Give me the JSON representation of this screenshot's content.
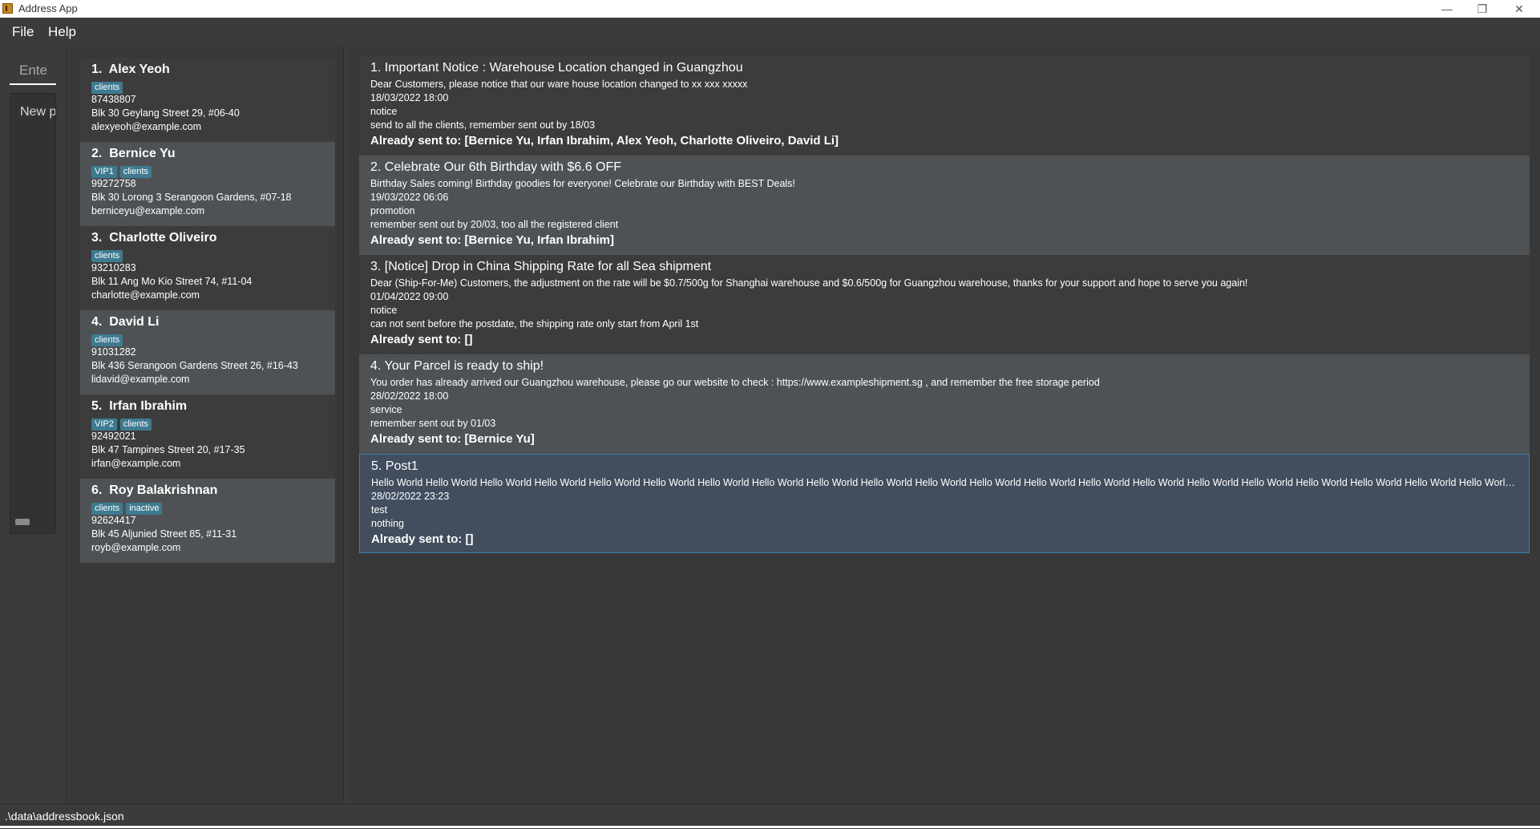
{
  "window": {
    "title": "Address App",
    "minimize": "—",
    "maximize": "❐",
    "close": "✕"
  },
  "menu": {
    "file": "File",
    "help": "Help"
  },
  "command_box": {
    "placeholder": "Ente"
  },
  "result_box": {
    "text": "New p"
  },
  "persons": [
    {
      "index": "1.",
      "name": "Alex Yeoh",
      "tags": [
        "clients"
      ],
      "phone": "87438807",
      "address": "Blk 30 Geylang Street 29, #06-40",
      "email": "alexyeoh@example.com"
    },
    {
      "index": "2.",
      "name": "Bernice Yu",
      "tags": [
        "VIP1",
        "clients"
      ],
      "phone": "99272758",
      "address": "Blk 30 Lorong 3 Serangoon Gardens, #07-18",
      "email": "berniceyu@example.com"
    },
    {
      "index": "3.",
      "name": "Charlotte Oliveiro",
      "tags": [
        "clients"
      ],
      "phone": "93210283",
      "address": "Blk 11 Ang Mo Kio Street 74, #11-04",
      "email": "charlotte@example.com"
    },
    {
      "index": "4.",
      "name": "David Li",
      "tags": [
        "clients"
      ],
      "phone": "91031282",
      "address": "Blk 436 Serangoon Gardens Street 26, #16-43",
      "email": "lidavid@example.com"
    },
    {
      "index": "5.",
      "name": "Irfan Ibrahim",
      "tags": [
        "VIP2",
        "clients"
      ],
      "phone": "92492021",
      "address": "Blk 47 Tampines Street 20, #17-35",
      "email": "irfan@example.com"
    },
    {
      "index": "6.",
      "name": "Roy Balakrishnan",
      "tags": [
        "clients",
        "inactive"
      ],
      "phone": "92624417",
      "address": "Blk 45 Aljunied Street 85, #11-31",
      "email": "royb@example.com"
    }
  ],
  "posts": [
    {
      "title": "1.  Important Notice :  Warehouse Location changed in Guangzhou",
      "content": "Dear Customers, please notice that our ware house location changed to xx xxx xxxxx",
      "datetime": "18/03/2022 18:00",
      "category": "notice",
      "note": "send to all the clients, remember sent out by 18/03",
      "sent": "Already sent to: [Bernice Yu, Irfan Ibrahim, Alex Yeoh, Charlotte Oliveiro, David Li]"
    },
    {
      "title": "2.  Celebrate Our 6th Birthday with $6.6 OFF",
      "content": "Birthday Sales coming! Birthday goodies for everyone! Celebrate our Birthday with BEST Deals!",
      "datetime": "19/03/2022 06:06",
      "category": "promotion",
      "note": "remember sent out by 20/03, too all the registered client",
      "sent": "Already sent to: [Bernice Yu, Irfan Ibrahim]"
    },
    {
      "title": "3.  [Notice] Drop in China Shipping Rate for all Sea shipment",
      "content": "Dear (Ship-For-Me) Customers, the adjustment on the rate will be $0.7/500g for Shanghai warehouse and $0.6/500g for Guangzhou warehouse, thanks for your support and hope to serve you again!",
      "datetime": "01/04/2022 09:00",
      "category": "notice",
      "note": "can not sent before the postdate, the shipping rate only start from April 1st",
      "sent": "Already sent to: []"
    },
    {
      "title": "4.  Your Parcel is ready to ship!",
      "content": "You order has already arrived our Guangzhou warehouse, please go our website to check : https://www.exampleshipment.sg , and remember the free storage period",
      "datetime": "28/02/2022 18:00",
      "category": "service",
      "note": "remember sent out by 01/03",
      "sent": "Already sent to: [Bernice Yu]"
    },
    {
      "title": "5.  Post1",
      "content": "Hello World Hello World Hello World Hello World Hello World Hello World Hello World Hello World Hello World Hello World Hello World Hello World Hello World Hello World Hello World Hello World Hello World Hello World Hello World Hello World Hello World Hello World Hello World Hello Wo...",
      "datetime": "28/02/2022 23:23",
      "category": "test",
      "note": "nothing",
      "sent": "Already sent to: []"
    }
  ],
  "status": {
    "file_path": ".\\data\\addressbook.json"
  }
}
